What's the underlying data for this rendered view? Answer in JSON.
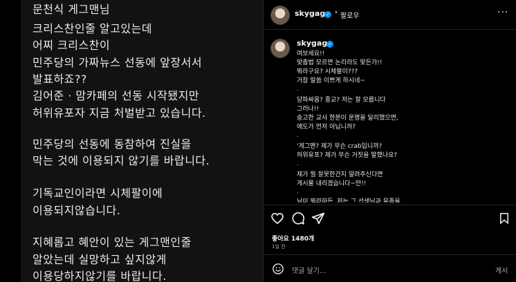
{
  "left_post": {
    "lines": [
      "문천식 게그맨님",
      "크리스찬인줄 알고있는데",
      "어찌 크리스찬이",
      "민주당의 가짜뉴스 선동에 앞장서서",
      "발표하죠??",
      "김어준 · 맘카페의 선동 시작됐지만",
      "허위유포자 지금 처벌받고 있습니다.",
      "민주당의 선동에 동참하여 진실을",
      "막는 것에 이용되지 않기를 바랍니다.",
      "기독교인이라면 시체팔이에",
      "이용되지않습니다.",
      "지혜롭고 혜안이 있는 게그맨인줄",
      "알았는데 실망하고 싶지않게",
      "이용당하지않기를 바랍니다."
    ]
  },
  "header": {
    "username": "skygag",
    "follow_label": "팔로우",
    "dot": "•",
    "more_label": "···"
  },
  "caption": {
    "username": "skygag",
    "lines": [
      "여보세요!!",
      "맞춤법 모르면 논리라도 맞든가!!",
      "뭐라구요? 시체팔이???",
      "거참 말씀 이쁘게 하시네~",
      ".",
      "당파싸움? 종교? 저는 잘 모릅니다",
      "그러나!!",
      "숭고한 교사 한분이 운명을 달리했으면,",
      "애도가 먼저 아닙니까?",
      ".",
      "'게그맨? 제가 무슨 crab입니까?",
      "허위유포? 제가 무슨 거짓을 말했나요?",
      ".",
      "제가 뭘 잘못한건지 알려주신다면",
      "게시물 내리겠습니다~만!!",
      ".",
      "님이 뭐라하든, 저는 그 선생님과 유족을"
    ]
  },
  "actions": {
    "likes_text": "좋아요 1480개",
    "time_text": "1일 전",
    "comment_placeholder": "댓글 달기...",
    "post_label": "게시"
  },
  "colors": {
    "verified": "#0095f6",
    "follow": "#e0f1ff",
    "panel": "#121212"
  }
}
